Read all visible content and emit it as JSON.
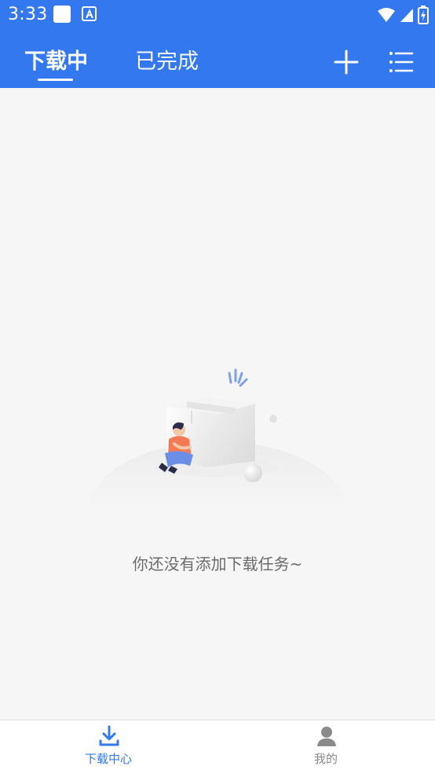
{
  "status_bar": {
    "time": "3:33"
  },
  "header": {
    "tabs": [
      {
        "label": "下载中",
        "active": true
      },
      {
        "label": "已完成",
        "active": false
      }
    ],
    "accent_color": "#3478f0"
  },
  "icons": {
    "add": "plus-icon",
    "menu": "list-menu-icon"
  },
  "empty_state": {
    "message": "你还没有添加下载任务~"
  },
  "bottom_nav": {
    "items": [
      {
        "label": "下载中心",
        "icon": "download-icon",
        "active": true
      },
      {
        "label": "我的",
        "icon": "person-icon",
        "active": false
      }
    ]
  }
}
